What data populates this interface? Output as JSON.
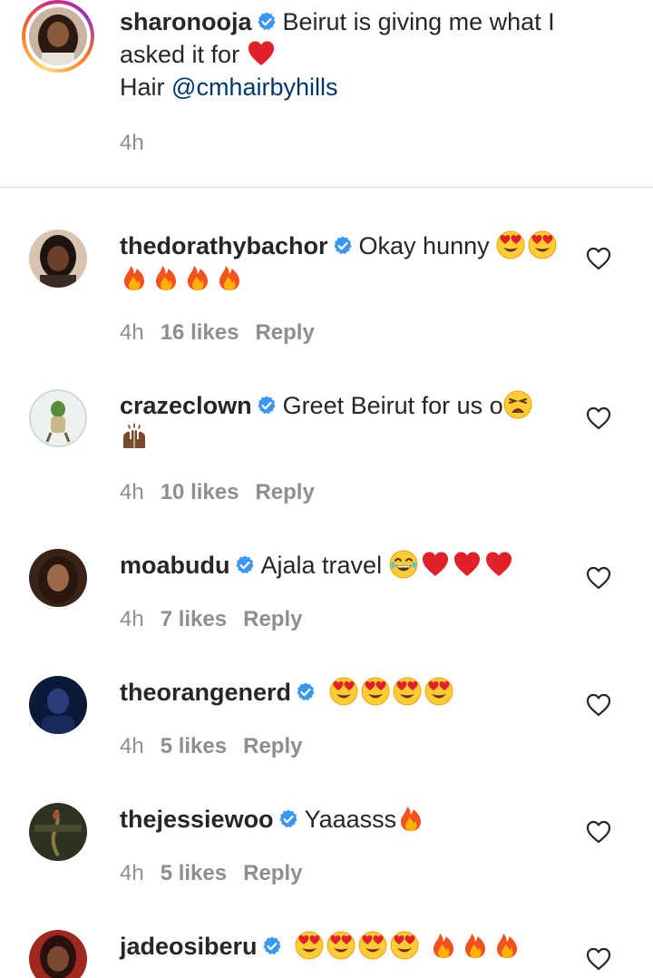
{
  "post": {
    "username": "sharonooja",
    "caption_line1": "Beirut is giving me what I",
    "caption_line2": "asked it for",
    "hair_label": "Hair",
    "mention": "@cmhairbyhills",
    "time": "4h",
    "avatar_icon": "user-avatar-woman"
  },
  "comments": [
    {
      "username": "thedorathybachor",
      "text": "Okay hunny",
      "time": "4h",
      "likes": "16 likes",
      "reply": "Reply"
    },
    {
      "username": "crazeclown",
      "text": "Greet Beirut for us o",
      "time": "4h",
      "likes": "10 likes",
      "reply": "Reply"
    },
    {
      "username": "moabudu",
      "text": "Ajala travel",
      "time": "4h",
      "likes": "7 likes",
      "reply": "Reply"
    },
    {
      "username": "theorangenerd",
      "text": "",
      "time": "4h",
      "likes": "5 likes",
      "reply": "Reply"
    },
    {
      "username": "thejessiewoo",
      "text": "Yaaasss",
      "time": "4h",
      "likes": "5 likes",
      "reply": "Reply"
    },
    {
      "username": "jadeosiberu",
      "text": "",
      "time": "",
      "likes": "",
      "reply": ""
    }
  ],
  "colors": {
    "verified": "#3897f0",
    "mention": "#00376b",
    "meta": "#8e8e8e",
    "text": "#262626"
  }
}
